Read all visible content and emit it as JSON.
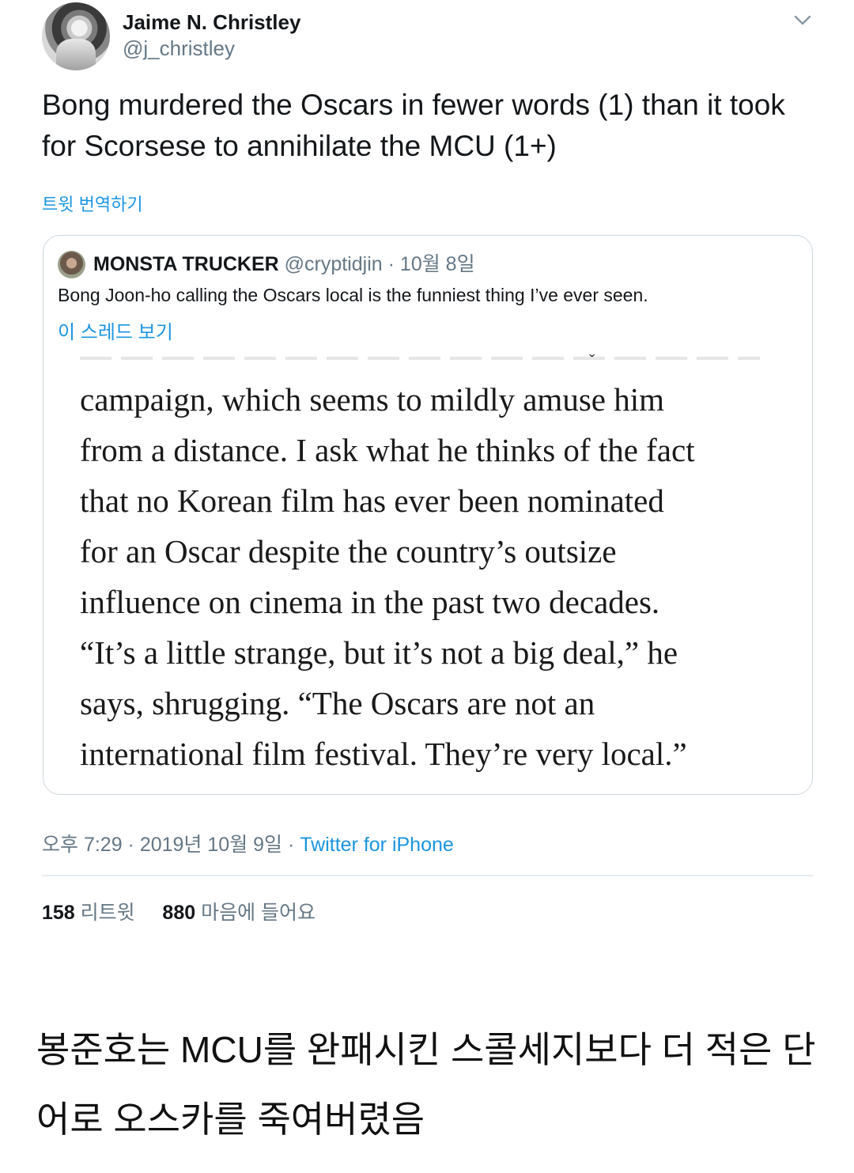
{
  "tweet": {
    "author_name": "Jaime N. Christley",
    "author_handle": "@j_christley",
    "text": "Bong murdered the Oscars in fewer words (1) than it took for Scorsese to annihilate the MCU (1+)",
    "translate_label": "트윗 번역하기",
    "timestamp": "오후 7:29 · 2019년 10월 9일 · ",
    "client": "Twitter for iPhone",
    "retweets_count": "158",
    "retweets_label": "리트윗",
    "likes_count": "880",
    "likes_label": "마음에 들어요"
  },
  "quoted_tweet": {
    "author_name": "MONSTA TRUCKER",
    "author_handle": "@cryptidjin",
    "date": "· 10월 8일",
    "text": "Bong Joon-ho calling the Oscars local is the funniest thing I’ve ever seen.",
    "thread_label": "이 스레드 보기",
    "image_lines": [
      "campaign, which seems to mildly amuse him",
      "from a distance. I ask what he thinks of the fact",
      "that no Korean film has ever been nominated",
      "for an Oscar despite the country’s outsize",
      "influence on cinema in the past two decades.",
      "“It’s a little strange, but it’s not a big deal,” he",
      "says, shrugging. “The Oscars are not an",
      "international film festival. They’re very local.”"
    ]
  },
  "caption": {
    "line1": "봉준호는 MCU를 완패시킨 스콜세지보다 더 적은 단",
    "line2": "어로 오스카를 죽여버렸음"
  },
  "icons": {
    "more": "chevron-down-icon"
  },
  "colors": {
    "link": "#1b95e0",
    "secondary_text": "#657786",
    "border": "#ccd6dd"
  }
}
